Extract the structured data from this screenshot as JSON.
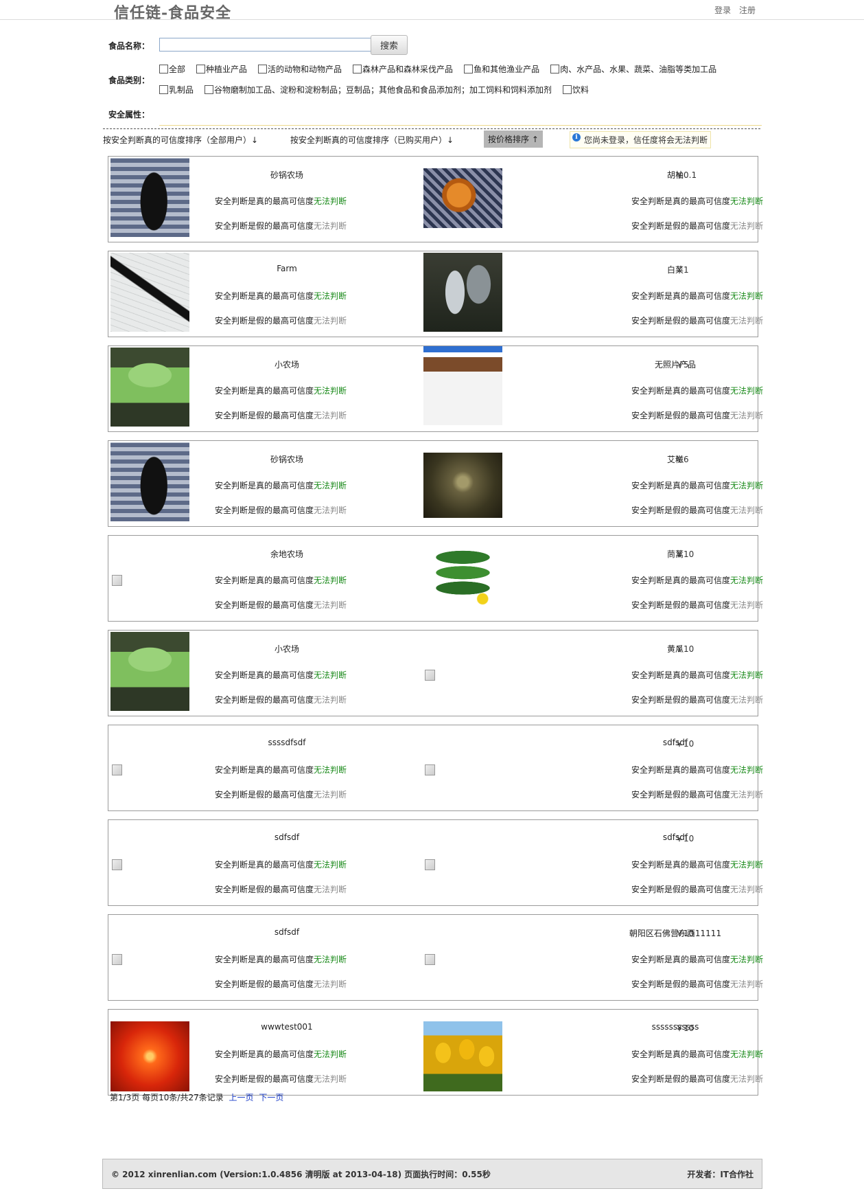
{
  "header": {
    "title": "信任链-食品安全",
    "login": "登录",
    "register": "注册"
  },
  "search": {
    "name_label": "食品名称：",
    "name_value": "",
    "button": "搜索",
    "category_label": "食品类别：",
    "categories_row1": [
      "全部",
      "种植业产品",
      "活的动物和动物产品",
      "森林产品和森林采伐产品",
      "鱼和其他渔业产品",
      "肉、水产品、水果、蔬菜、油脂等类加工品"
    ],
    "categories_row2": [
      "乳制品",
      "谷物磨制加工品、淀粉和淀粉制品；豆制品；其他食品和食品添加剂；加工饲料和饲料添加剂",
      "饮料"
    ],
    "attr_label": "安全属性："
  },
  "sort": {
    "all_users": "按安全判断真的可信度排序（全部用户）↓",
    "buyers": "按安全判断真的可信度排序（已购买用户）↓",
    "price": "按价格排序 ↑",
    "notice": "您尚未登录，信任度将会无法判断"
  },
  "labels": {
    "true_prefix": "安全判断是真的最高可信度",
    "false_prefix": "安全判断是假的最高可信度",
    "unknown": "无法判断"
  },
  "rows": [
    {
      "left": {
        "farm": "砂锅农场",
        "img": "dark-leaf"
      },
      "right": {
        "farm": "胡柚",
        "img": "orange-flower"
      },
      "price": "￥0.1"
    },
    {
      "left": {
        "farm": "Farm",
        "img": "pen-sketch"
      },
      "right": {
        "farm": "白菜",
        "img": "leafy-plant"
      },
      "price": "￥1"
    },
    {
      "left": {
        "farm": "小农场",
        "img": "green-chair"
      },
      "right": {
        "farm": "无照片产品",
        "img": "phone-screen"
      },
      "price": "￥5"
    },
    {
      "left": {
        "farm": "砂锅农场",
        "img": "dark-leaf"
      },
      "right": {
        "farm": "艾糍",
        "img": "dim-bowl"
      },
      "price": "￥6"
    },
    {
      "left": {
        "farm": "余地农场",
        "img": "broken"
      },
      "right": {
        "farm": "茼蒿",
        "img": "cucumbers"
      },
      "price": "￥10"
    },
    {
      "left": {
        "farm": "小农场",
        "img": "green-chair"
      },
      "right": {
        "farm": "黄瓜",
        "img": "broken"
      },
      "price": "￥10"
    },
    {
      "left": {
        "farm": "ssssdfsdf",
        "img": "broken"
      },
      "right": {
        "farm": "sdfsdf",
        "img": "broken"
      },
      "price": "￥10"
    },
    {
      "left": {
        "farm": "sdfsdf",
        "img": "broken"
      },
      "right": {
        "farm": "sdfsdf",
        "img": "broken"
      },
      "price": "￥10"
    },
    {
      "left": {
        "farm": "sdfsdf",
        "img": "broken"
      },
      "right": {
        "farm": "朝阳区石佛营东西11111",
        "img": "broken"
      },
      "price": "￥10"
    },
    {
      "left": {
        "farm": "wwwtest001",
        "img": "red-flower"
      },
      "right": {
        "farm": "sssssssssss",
        "img": "tulips"
      },
      "price": "￥10"
    }
  ],
  "pager": {
    "info": "第1/3页  每页10条/共27条记录",
    "prev": "上一页",
    "next": "下一页"
  },
  "footer": {
    "left": "© 2012 xinrenlian.com (Version:1.0.4856 清明版 at 2013-04-18)   页面执行时间：0.55秒",
    "right": "开发者：IT合作社"
  }
}
